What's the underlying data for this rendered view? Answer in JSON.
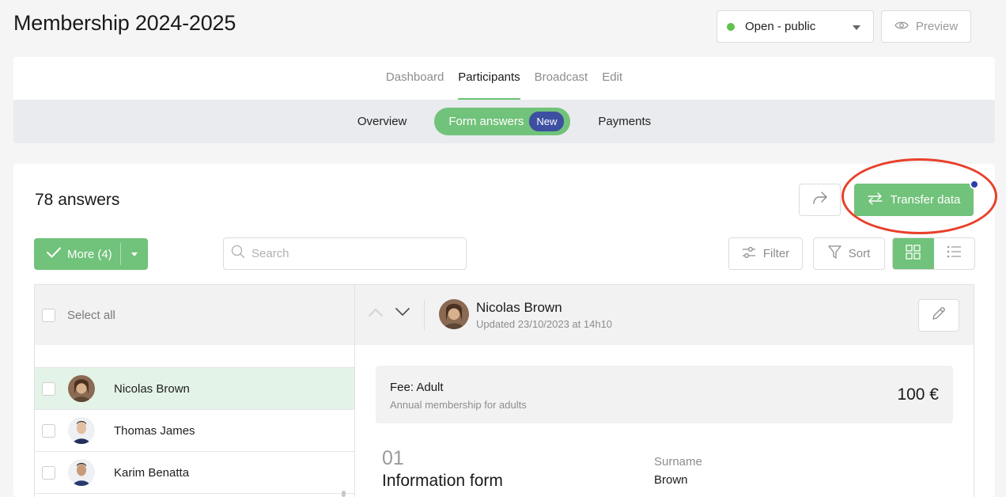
{
  "page": {
    "title": "Membership 2024-2025"
  },
  "status_select": {
    "value": "Open - public",
    "dot_color": "#5fc24a"
  },
  "preview": {
    "label": "Preview"
  },
  "tabs": [
    {
      "label": "Dashboard",
      "active": false
    },
    {
      "label": "Participants",
      "active": true
    },
    {
      "label": "Broadcast",
      "active": false
    },
    {
      "label": "Edit",
      "active": false
    }
  ],
  "subtabs": {
    "overview": "Overview",
    "form_answers": "Form answers",
    "new_badge": "New",
    "payments": "Payments"
  },
  "answers": {
    "count_label": "78 answers"
  },
  "toolbar": {
    "transfer_label": "Transfer data",
    "more_label": "More (4)",
    "search_placeholder": "Search",
    "filter_label": "Filter",
    "sort_label": "Sort"
  },
  "list": {
    "select_all": "Select all",
    "rows": [
      {
        "name": "Nicolas Brown",
        "selected": true
      },
      {
        "name": "Thomas James",
        "selected": false
      },
      {
        "name": "Karim Benatta",
        "selected": false
      }
    ]
  },
  "detail": {
    "name": "Nicolas Brown",
    "updated": "Updated 23/10/2023 at 14h10",
    "fee": {
      "title": "Fee: Adult",
      "description": "Annual membership for adults",
      "amount": "100 €"
    },
    "section": {
      "number": "01",
      "title": "Information form"
    },
    "field": {
      "label": "Surname",
      "value": "Brown"
    }
  },
  "colors": {
    "accent": "#71c27a",
    "badge": "#3d4fa0",
    "highlight": "#e8402a",
    "notification": "#2b3fa6"
  },
  "icons": [
    "chevron-down-icon",
    "eye-icon",
    "share-icon",
    "transfer-arrows-icon",
    "check-icon",
    "search-icon",
    "sliders-icon",
    "funnel-icon",
    "grid-icon",
    "list-icon",
    "chevron-up-icon",
    "pencil-icon"
  ]
}
